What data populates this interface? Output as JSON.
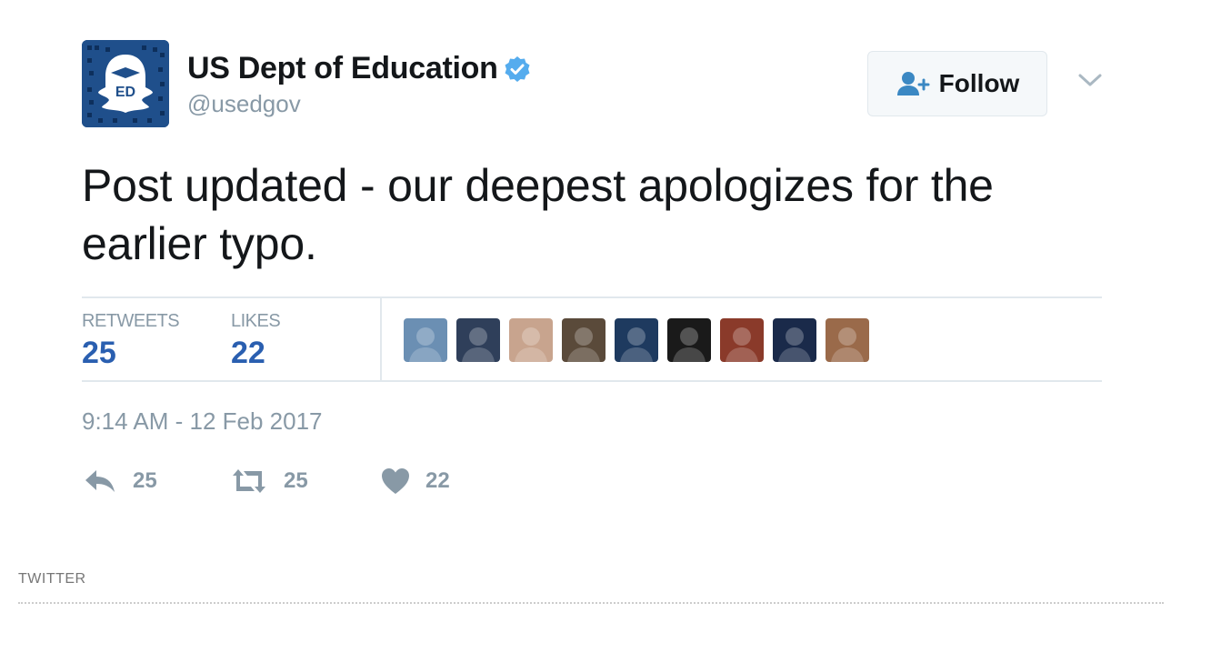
{
  "tweet": {
    "display_name": "US Dept of Education",
    "handle": "@usedgov",
    "verified": true,
    "follow_label": "Follow",
    "text": "Post updated - our deepest apologizes for the earlier typo.",
    "stats": {
      "retweets_label": "RETWEETS",
      "retweets_count": "25",
      "likes_label": "LIKES",
      "likes_count": "22"
    },
    "timestamp": "9:14 AM - 12 Feb 2017",
    "actions": {
      "reply_count": "25",
      "retweet_count": "25",
      "like_count": "22"
    },
    "likers": [
      {
        "icon": "liker-avatar-1",
        "color": "#6b8fb3"
      },
      {
        "icon": "liker-avatar-2",
        "color": "#2f3f5a"
      },
      {
        "icon": "liker-avatar-3",
        "color": "#c8a48e"
      },
      {
        "icon": "liker-avatar-4",
        "color": "#5a4a3a"
      },
      {
        "icon": "liker-avatar-5",
        "color": "#1e3a5f"
      },
      {
        "icon": "liker-avatar-6",
        "color": "#1a1a1a"
      },
      {
        "icon": "liker-avatar-7",
        "color": "#8a3a2a"
      },
      {
        "icon": "liker-avatar-8",
        "color": "#1a2a4a"
      },
      {
        "icon": "liker-avatar-9",
        "color": "#9a6a4a"
      }
    ]
  },
  "source": {
    "label": "TWITTER"
  },
  "colors": {
    "accent": "#2a5fb0",
    "verified": "#55acee",
    "muted": "#8899a6",
    "avatar_bg": "#1f4f8b"
  }
}
